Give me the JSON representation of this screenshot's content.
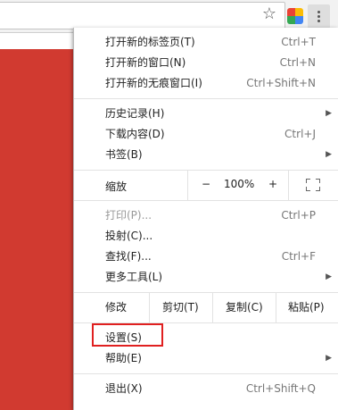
{
  "toolbar": {
    "bookmark_icon": "star-icon",
    "extension_icon": "extension-icon",
    "menu_icon": "kebab-menu-icon",
    "bookmark_glyph": "☆"
  },
  "menu": {
    "new_tab": {
      "label": "打开新的标签页(T)",
      "shortcut": "Ctrl+T"
    },
    "new_window": {
      "label": "打开新的窗口(N)",
      "shortcut": "Ctrl+N"
    },
    "new_incognito": {
      "label": "打开新的无痕窗口(I)",
      "shortcut": "Ctrl+Shift+N"
    },
    "history": {
      "label": "历史记录(H)"
    },
    "downloads": {
      "label": "下载内容(D)",
      "shortcut": "Ctrl+J"
    },
    "bookmarks": {
      "label": "书签(B)"
    },
    "zoom": {
      "label": "缩放",
      "minus": "−",
      "value": "100%",
      "plus": "+"
    },
    "print": {
      "label": "打印(P)...",
      "shortcut": "Ctrl+P"
    },
    "cast": {
      "label": "投射(C)..."
    },
    "find": {
      "label": "查找(F)...",
      "shortcut": "Ctrl+F"
    },
    "more_tools": {
      "label": "更多工具(L)"
    },
    "edit": {
      "label": "修改",
      "cut": "剪切(T)",
      "copy": "复制(C)",
      "paste": "粘贴(P)"
    },
    "settings": {
      "label": "设置(S)"
    },
    "help": {
      "label": "帮助(E)"
    },
    "exit": {
      "label": "退出(X)",
      "shortcut": "Ctrl+Shift+Q"
    },
    "submenu_arrow": "▶"
  },
  "colors": {
    "page_background": "#d13a30",
    "highlight_box": "#e02020"
  }
}
